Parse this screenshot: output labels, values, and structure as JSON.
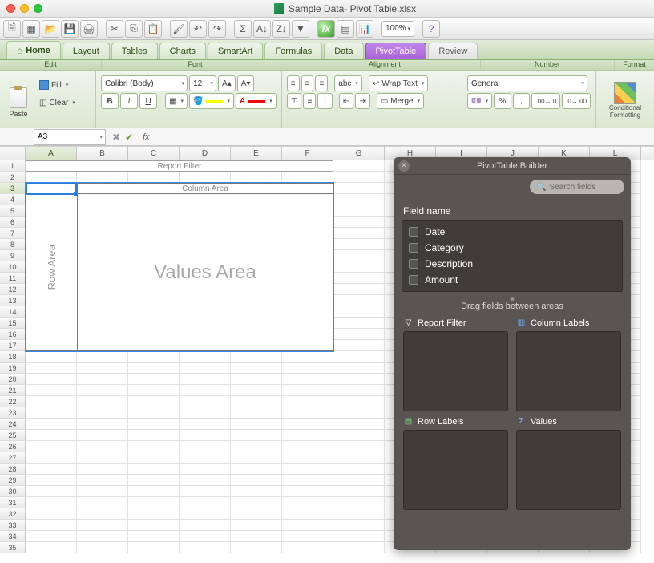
{
  "window": {
    "title": "Sample Data- Pivot Table.xlsx"
  },
  "toolbar": {
    "zoom": "100%"
  },
  "tabs": [
    "Home",
    "Layout",
    "Tables",
    "Charts",
    "SmartArt",
    "Formulas",
    "Data",
    "PivotTable",
    "Review"
  ],
  "ribbon_groups": {
    "edit": "Edit",
    "font": "Font",
    "alignment": "Alignment",
    "number": "Number",
    "format": "Format"
  },
  "ribbon": {
    "paste": "Paste",
    "fill": "Fill",
    "clear": "Clear",
    "font_name": "Calibri (Body)",
    "font_size": "12",
    "wrap_text": "Wrap Text",
    "merge": "Merge",
    "number_format": "General",
    "abc": "abc",
    "cond_format": "Conditional Formatting"
  },
  "namebox": "A3",
  "columns": [
    "A",
    "B",
    "C",
    "D",
    "E",
    "F",
    "G",
    "H",
    "I",
    "J",
    "K",
    "L"
  ],
  "rows": 35,
  "pivot_zone": {
    "filter": "Report Filter",
    "column": "Column Area",
    "row": "Row Area",
    "values": "Values Area"
  },
  "ptb": {
    "title": "PivotTable Builder",
    "search_placeholder": "Search fields",
    "field_label": "Field name",
    "fields": [
      "Date",
      "Category",
      "Description",
      "Amount"
    ],
    "drag_hint": "Drag fields between areas",
    "areas": {
      "filter": "Report Filter",
      "columns": "Column Labels",
      "rows": "Row Labels",
      "values": "Values"
    }
  }
}
